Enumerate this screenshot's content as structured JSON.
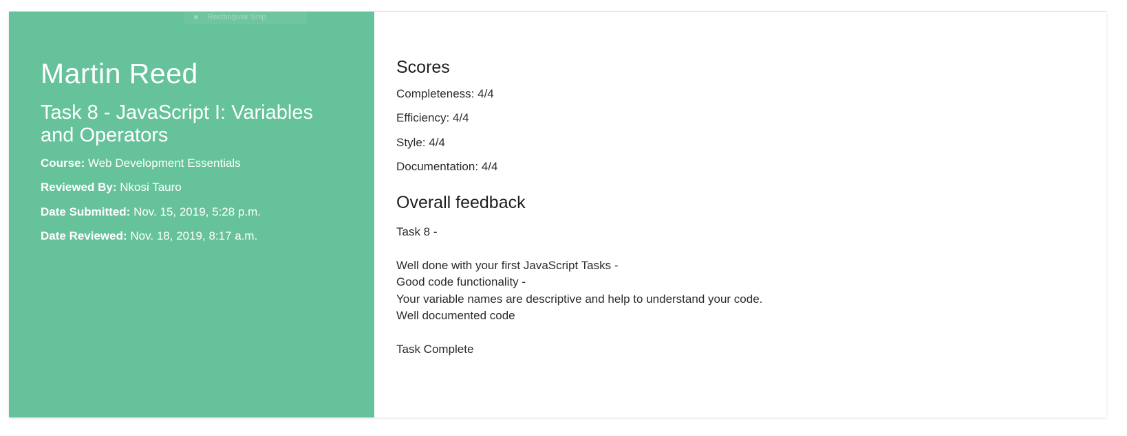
{
  "snip_ghost": {
    "label": "Rectangular Snip"
  },
  "student": {
    "name": "Martin Reed",
    "task_title": "Task 8 - JavaScript I: Variables and Operators",
    "meta": [
      {
        "key": "Course:",
        "value": "Web Development Essentials"
      },
      {
        "key": "Reviewed By:",
        "value": "Nkosi Tauro"
      },
      {
        "key": "Date Submitted:",
        "value": "Nov. 15, 2019, 5:28 p.m."
      },
      {
        "key": "Date Reviewed:",
        "value": "Nov. 18, 2019, 8:17 a.m."
      }
    ]
  },
  "scores": {
    "title": "Scores",
    "items": [
      "Completeness: 4/4",
      "Efficiency: 4/4",
      "Style: 4/4",
      "Documentation: 4/4"
    ]
  },
  "feedback": {
    "title": "Overall feedback",
    "lines": [
      "Task 8 -",
      "",
      "Well done with your first JavaScript Tasks -",
      "Good code functionality -",
      "Your variable names are descriptive and help to understand your code.",
      "Well documented code",
      "",
      "Task Complete"
    ]
  },
  "colors": {
    "panel_green": "#66c29b",
    "text_dark": "#2b2b2b"
  }
}
